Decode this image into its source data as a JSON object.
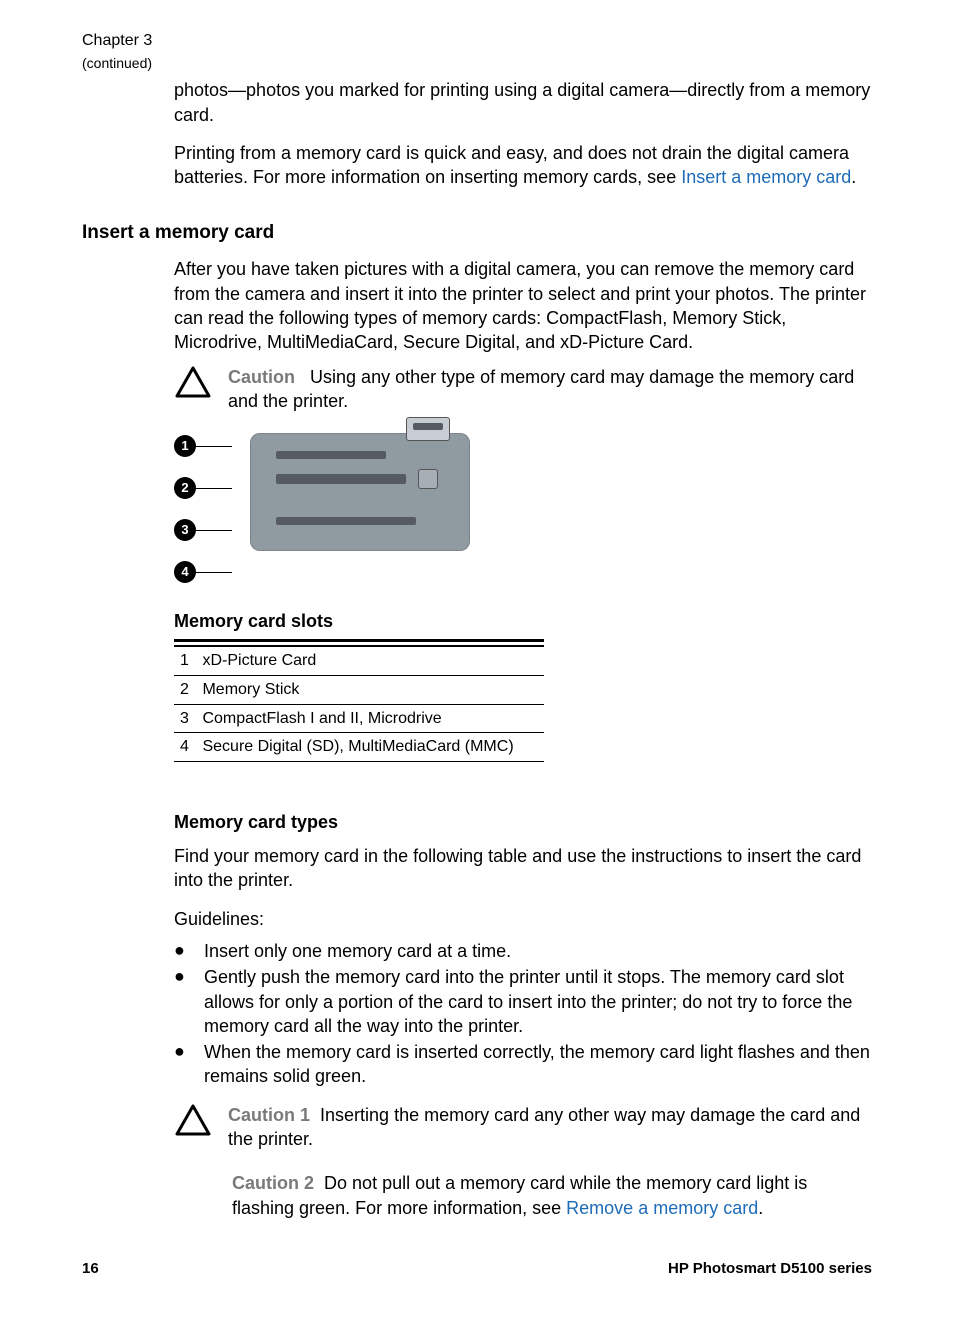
{
  "header": {
    "chapter": "Chapter 3",
    "continued": "(continued)"
  },
  "intro": {
    "p1_a": "photos—photos you marked for printing using a digital camera—directly from a memory card.",
    "p2_a": "Printing from a memory card is quick and easy, and does not drain the digital camera batteries. For more information on inserting memory cards, see ",
    "p2_link": "Insert a memory card",
    "p2_b": "."
  },
  "section1": {
    "title": "Insert a memory card",
    "p1": "After you have taken pictures with a digital camera, you can remove the memory card from the camera and insert it into the printer to select and print your photos. The printer can read the following types of memory cards: CompactFlash, Memory Stick, Microdrive, MultiMediaCard, Secure Digital, and xD-Picture Card.",
    "caution": {
      "label": "Caution",
      "text": "Using any other type of memory card may damage the memory card and the printer."
    }
  },
  "figure": {
    "callouts": [
      "1",
      "2",
      "3",
      "4"
    ]
  },
  "table": {
    "title": "Memory card slots",
    "rows": [
      {
        "n": "1",
        "label": "xD-Picture Card"
      },
      {
        "n": "2",
        "label": "Memory Stick"
      },
      {
        "n": "3",
        "label": "CompactFlash I and II, Microdrive"
      },
      {
        "n": "4",
        "label": "Secure Digital (SD), MultiMediaCard (MMC)"
      }
    ]
  },
  "section2": {
    "title": "Memory card types",
    "p1": "Find your memory card in the following table and use the instructions to insert the card into the printer.",
    "guidelines_label": "Guidelines:",
    "bullets": [
      "Insert only one memory card at a time.",
      "Gently push the memory card into the printer until it stops. The memory card slot allows for only a portion of the card to insert into the printer; do not try to force the memory card all the way into the printer.",
      "When the memory card is inserted correctly, the memory card light flashes and then remains solid green."
    ],
    "caution1": {
      "label": "Caution 1",
      "text": "Inserting the memory card any other way may damage the card and the printer."
    },
    "caution2": {
      "label": "Caution 2",
      "text_a": "Do not pull out a memory card while the memory card light is flashing green. For more information, see ",
      "link": "Remove a memory card",
      "text_b": "."
    }
  },
  "footer": {
    "page": "16",
    "product": "HP Photosmart D5100 series"
  }
}
